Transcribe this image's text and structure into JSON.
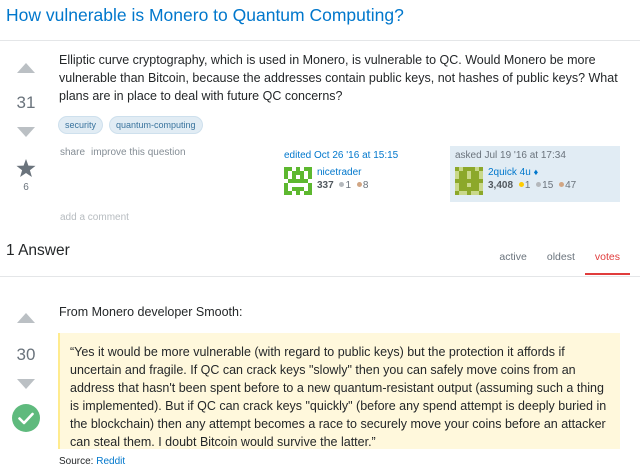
{
  "question": {
    "title": "How vulnerable is Monero to Quantum Computing?",
    "votes": "31",
    "favorites": "6",
    "body": "Elliptic curve cryptography, which is used in Monero, is vulnerable to QC. Would Monero be more vulnerable than Bitcoin, because the addresses contain public keys, not hashes of public keys? What plans are in place to deal with future QC concerns?",
    "tags": [
      "security",
      "quantum-computing"
    ],
    "menu": {
      "share": "share",
      "improve": "improve this question"
    },
    "add_comment": "add a comment",
    "editor": {
      "action": "edited Oct 26 '16 at 15:15",
      "name": "nicetrader",
      "rep": "337",
      "silver": "1",
      "bronze": "8"
    },
    "asker": {
      "action": "asked Jul 19 '16 at 17:34",
      "name": "2quick 4u",
      "rep": "3,408",
      "gold": "1",
      "silver": "15",
      "bronze": "47"
    }
  },
  "answers": {
    "count_label": "1 Answer",
    "tabs": [
      "active",
      "oldest",
      "votes"
    ],
    "active_tab": "votes"
  },
  "answer": {
    "votes": "30",
    "intro": "From Monero developer Smooth:",
    "quote": "“Yes it would be more vulnerable (with regard to public keys) but the protection it affords if uncertain and fragile. If QC can crack keys \"slowly\" then you can safely move coins from an address that hasn't been spent before to a new quantum-resistant output (assuming such a thing is implemented). But if QC can crack keys \"quickly\" (before any spend attempt is deeply buried in the blockchain) then any attempt becomes a race to securely move your coins before an attacker can steal them. I doubt Bitcoin would survive the latter.”",
    "source_label": "Source:",
    "source_link": "Reddit"
  },
  "colors": {
    "link": "#0077cc",
    "accepted": "#5fba7d",
    "tag_bg": "#e1ecf4",
    "quote_bg": "#fff8dc",
    "active_tab": "#e03c3c"
  },
  "icons": [
    "up-arrow-icon",
    "down-arrow-icon",
    "favorite-star-icon",
    "accepted-check-icon",
    "diamond-moderator-icon"
  ]
}
